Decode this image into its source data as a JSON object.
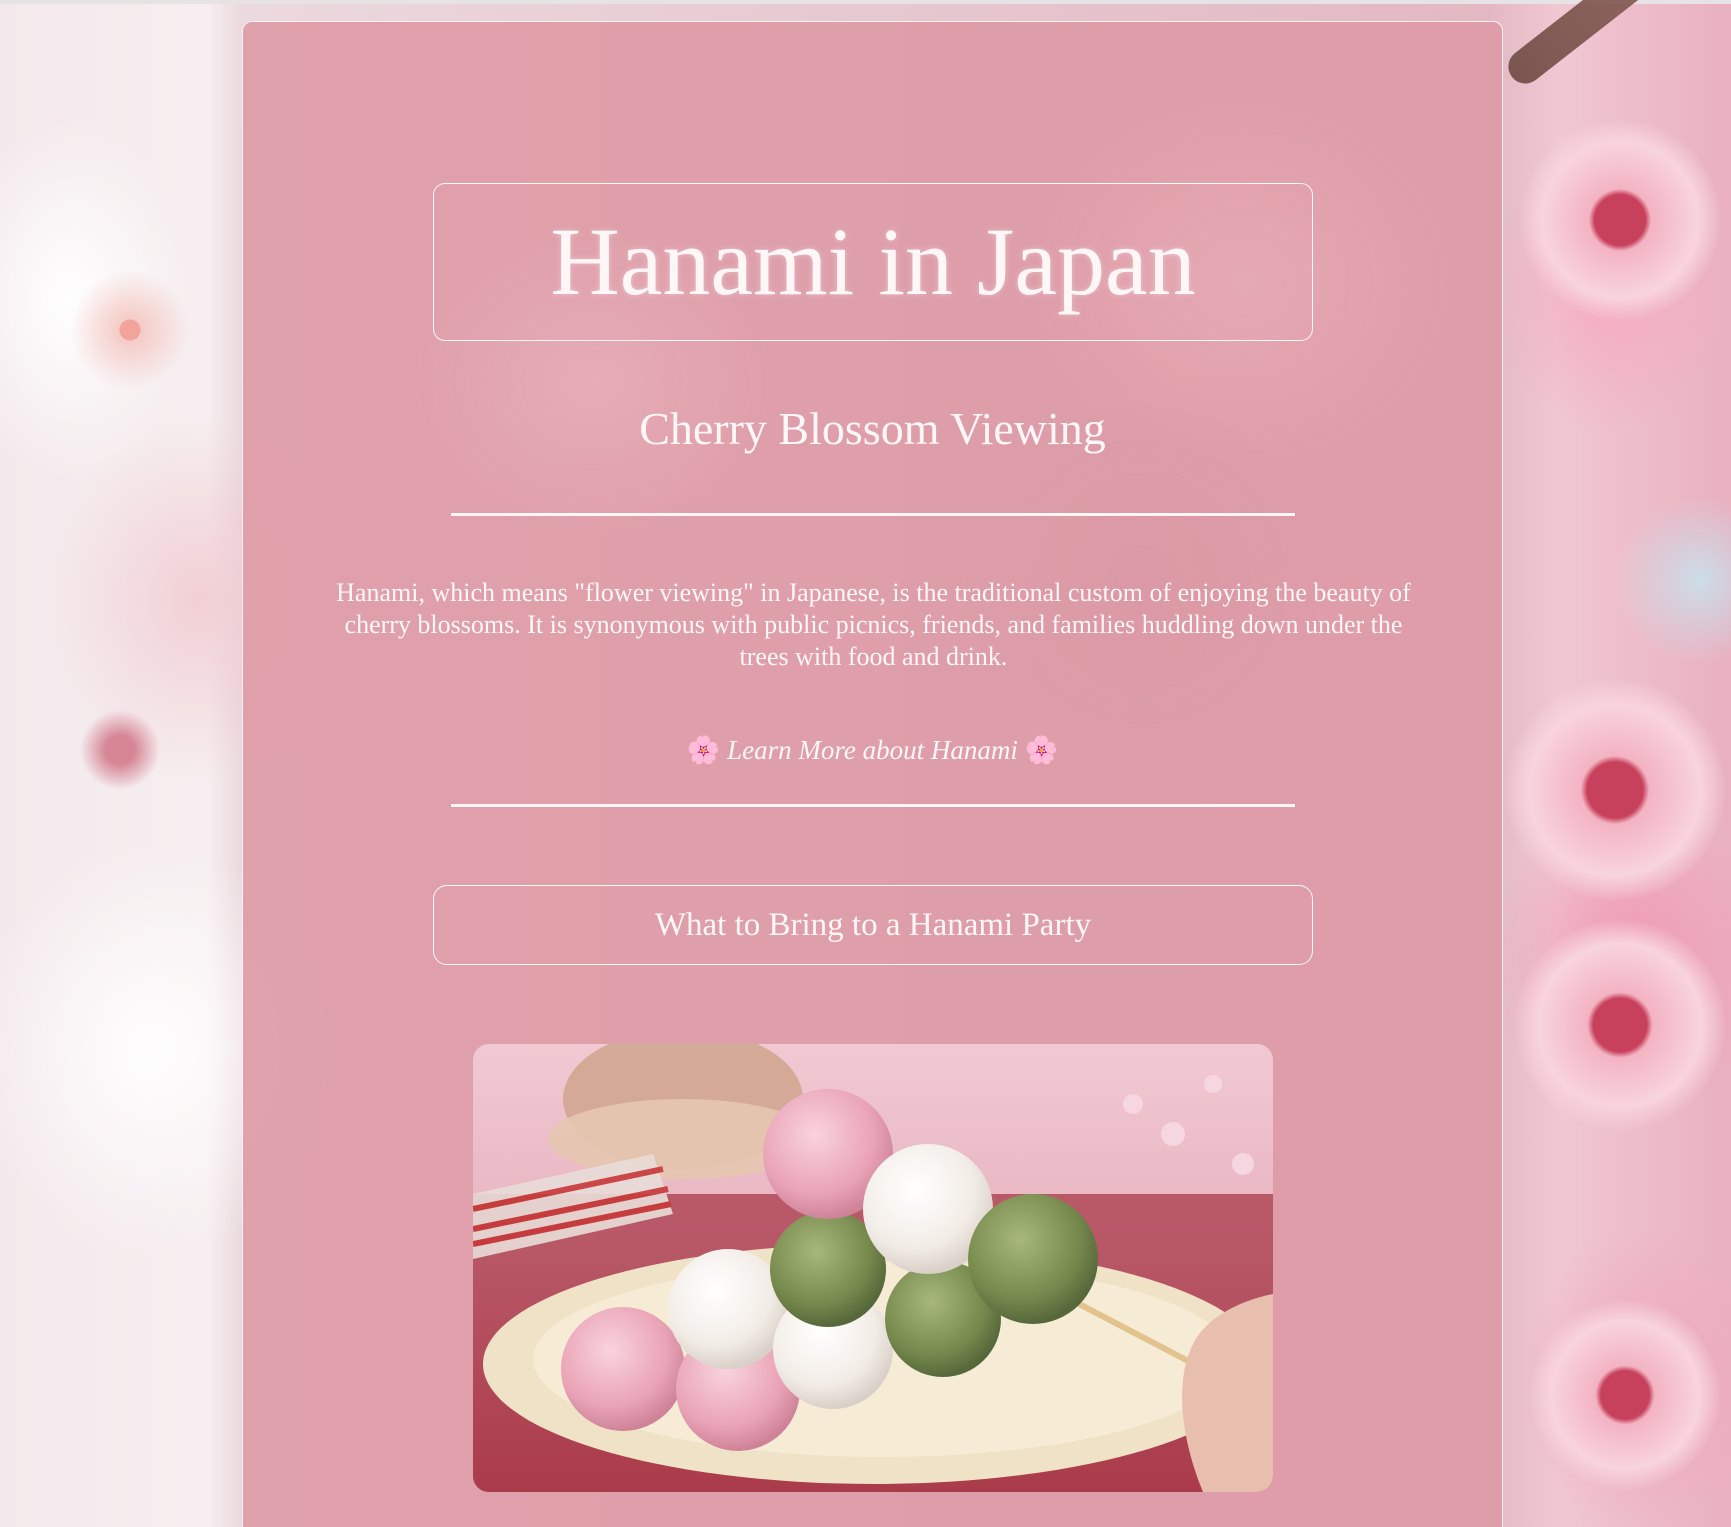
{
  "page": {
    "title": "Hanami in Japan",
    "subtitle": "Cherry Blossom Viewing",
    "intro": "Hanami, which means \"flower viewing\" in Japanese, is the traditional custom of enjoying the beauty of cherry blossoms. It is synonymous with public picnics, friends, and families huddling down under the trees with food and drink.",
    "learn_more": {
      "icon": "🌸",
      "label": "Learn More about Hanami"
    },
    "party_button_label": "What to Bring to a Hanami Party"
  },
  "colors": {
    "card_background": "#dd98a4",
    "text": "#fff7f7",
    "border": "#ffffff",
    "background_blossom": "#f3b3c3"
  },
  "icons": {
    "flower": "cherry-blossom-icon"
  }
}
